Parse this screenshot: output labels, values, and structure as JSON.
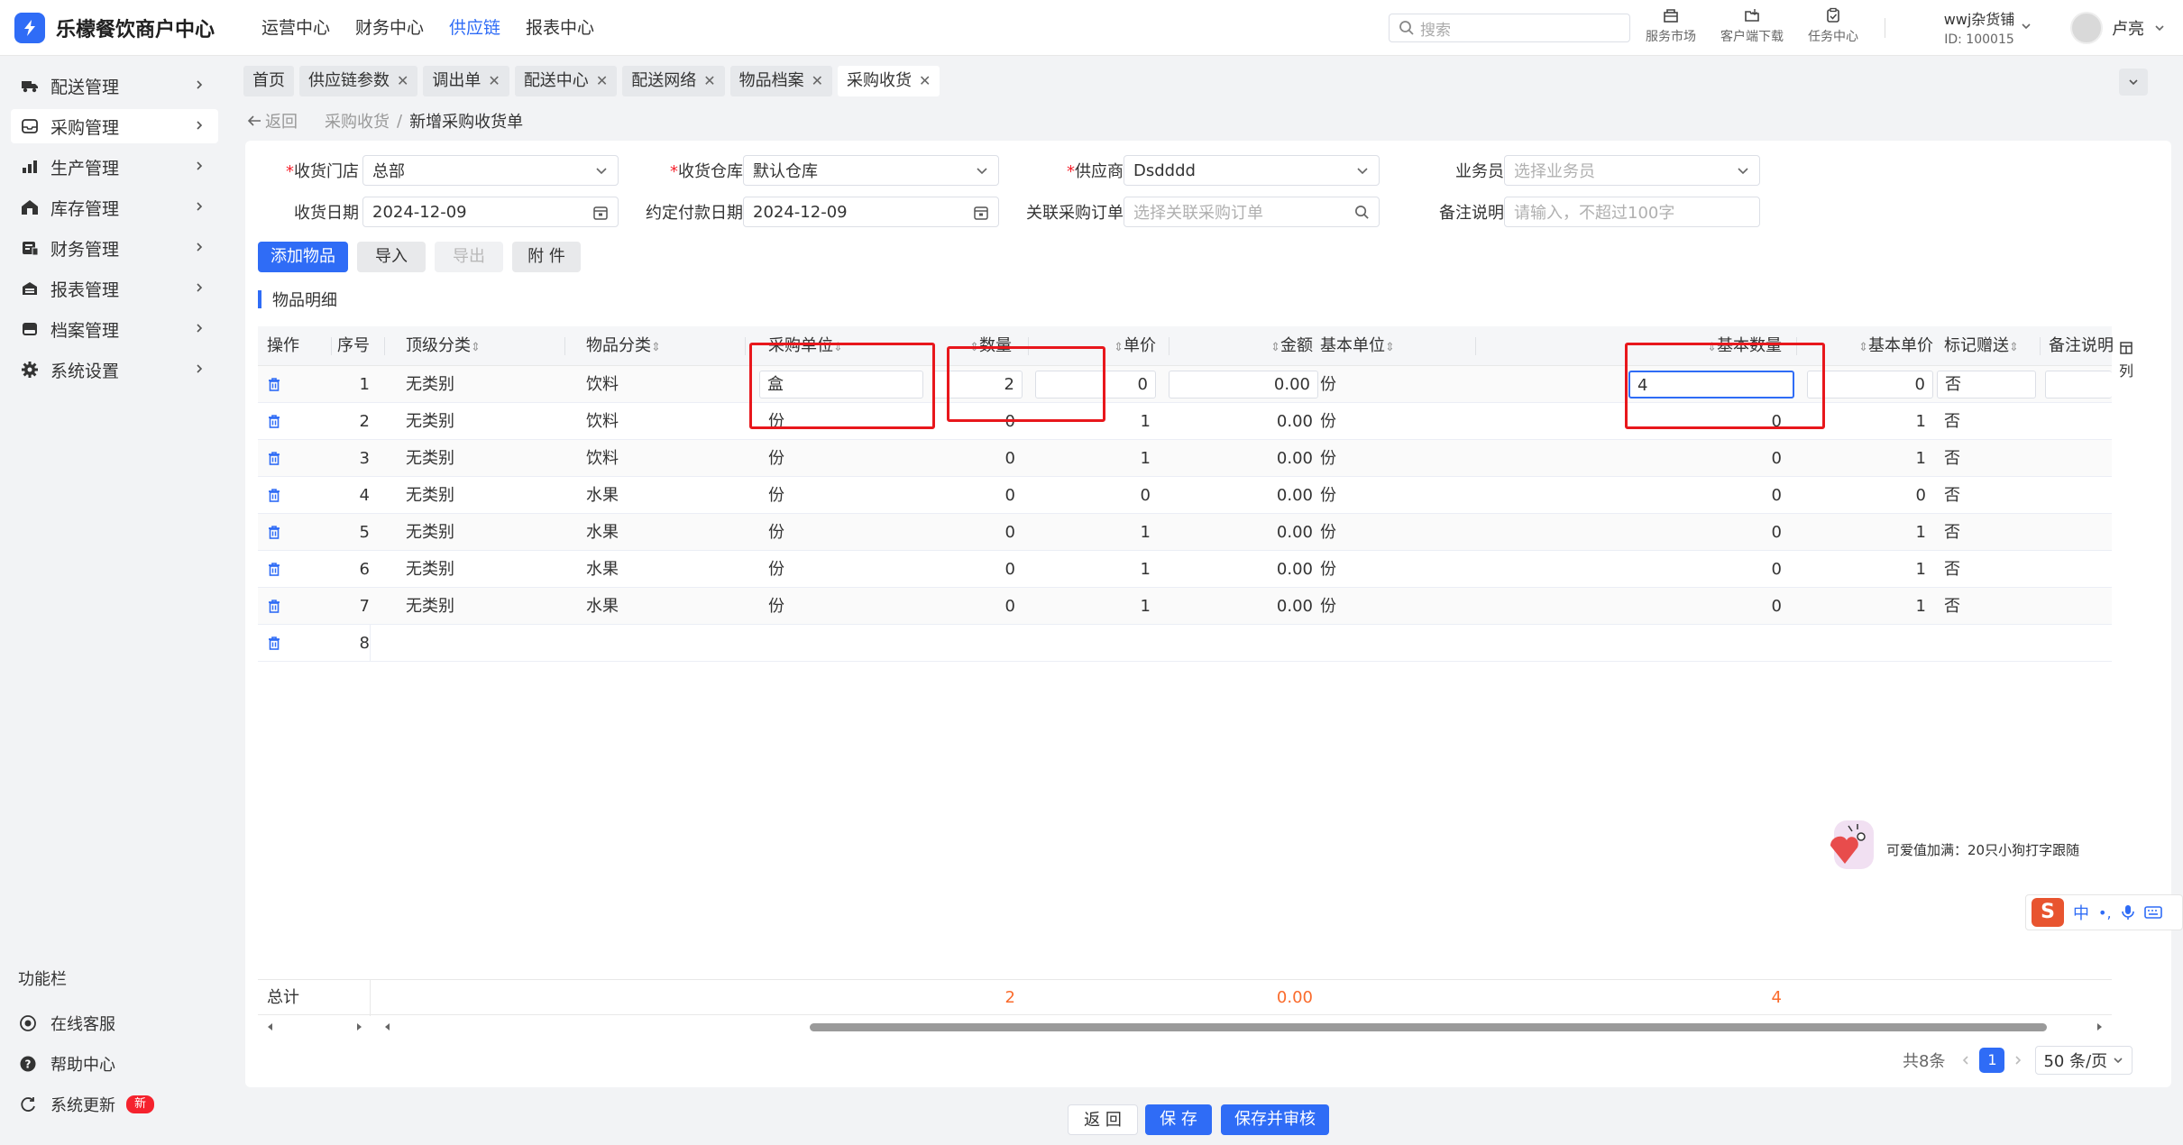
{
  "app": {
    "title": "乐檬餐饮商户中心",
    "top_nav": [
      {
        "label": "运营中心",
        "active": false
      },
      {
        "label": "财务中心",
        "active": false
      },
      {
        "label": "供应链",
        "active": true
      },
      {
        "label": "报表中心",
        "active": false
      }
    ],
    "search_placeholder": "搜索",
    "tools": [
      {
        "label": "服务市场",
        "icon": "store-icon"
      },
      {
        "label": "客户端下载",
        "icon": "download-icon"
      },
      {
        "label": "任务中心",
        "icon": "task-icon"
      }
    ],
    "store_name": "wwj杂货铺",
    "store_id": "ID: 100015",
    "user_name": "卢亮",
    "accent_color": "#2f6cf6"
  },
  "sidebar": {
    "items": [
      {
        "label": "配送管理",
        "icon": "truck-icon",
        "active": false
      },
      {
        "label": "采购管理",
        "icon": "inbox-icon",
        "active": true
      },
      {
        "label": "生产管理",
        "icon": "chart-icon",
        "active": false
      },
      {
        "label": "库存管理",
        "icon": "warehouse-icon",
        "active": false
      },
      {
        "label": "财务管理",
        "icon": "finance-icon",
        "active": false
      },
      {
        "label": "报表管理",
        "icon": "report-icon",
        "active": false
      },
      {
        "label": "档案管理",
        "icon": "archive-icon",
        "active": false
      },
      {
        "label": "系统设置",
        "icon": "gear-icon",
        "active": false
      }
    ],
    "footer_title": "功能栏",
    "footer_items": [
      {
        "label": "在线客服",
        "icon": "headset-icon"
      },
      {
        "label": "帮助中心",
        "icon": "help-icon"
      },
      {
        "label": "系统更新",
        "icon": "refresh-icon",
        "badge": "新"
      }
    ]
  },
  "tabs": [
    {
      "label": "首页",
      "closable": false,
      "active": false
    },
    {
      "label": "供应链参数",
      "closable": true,
      "active": false
    },
    {
      "label": "调出单",
      "closable": true,
      "active": false
    },
    {
      "label": "配送中心",
      "closable": true,
      "active": false
    },
    {
      "label": "配送网络",
      "closable": true,
      "active": false
    },
    {
      "label": "物品档案",
      "closable": true,
      "active": false
    },
    {
      "label": "采购收货",
      "closable": true,
      "active": true
    }
  ],
  "breadcrumb": {
    "back": "返回",
    "parent": "采购收货",
    "sep": "/",
    "current": "新增采购收货单"
  },
  "form": {
    "store_label": "收货门店",
    "store_value": "总部",
    "warehouse_label": "收货仓库",
    "warehouse_value": "默认仓库",
    "supplier_label": "供应商",
    "supplier_value": "Dsdddd",
    "salesman_label": "业务员",
    "salesman_placeholder": "选择业务员",
    "date_label": "收货日期",
    "date_value": "2024-12-09",
    "paydate_label": "约定付款日期",
    "paydate_value": "2024-12-09",
    "order_label": "关联采购订单",
    "order_placeholder": "选择关联采购订单",
    "remark_label": "备注说明",
    "remark_placeholder": "请输入，不超过100字",
    "required_mark": "*"
  },
  "actions": {
    "add": "添加物品",
    "import": "导入",
    "export": "导出",
    "attach": "附 件"
  },
  "section_title": "物品明细",
  "table": {
    "headers": {
      "op": "操作",
      "seq": "序号",
      "top_cat": "顶级分类",
      "cat": "物品分类",
      "unit": "采购单位",
      "qty": "数量",
      "price": "单价",
      "amount": "金额",
      "base_unit": "基本单位",
      "base_qty": "基本数量",
      "base_price": "基本单价",
      "gift": "标记赠送",
      "remark": "备注说明"
    },
    "sort_glyph": "⇕",
    "rows": [
      {
        "seq": "1",
        "top_cat": "无类别",
        "cat": "饮料",
        "unit": "盒",
        "qty": "2",
        "price": "0",
        "amount": "0.00",
        "base_unit": "份",
        "base_qty": "4",
        "base_price": "0",
        "gift": "否"
      },
      {
        "seq": "2",
        "top_cat": "无类别",
        "cat": "饮料",
        "unit": "份",
        "qty": "0",
        "price": "1",
        "amount": "0.00",
        "base_unit": "份",
        "base_qty": "0",
        "base_price": "1",
        "gift": "否"
      },
      {
        "seq": "3",
        "top_cat": "无类别",
        "cat": "饮料",
        "unit": "份",
        "qty": "0",
        "price": "1",
        "amount": "0.00",
        "base_unit": "份",
        "base_qty": "0",
        "base_price": "1",
        "gift": "否"
      },
      {
        "seq": "4",
        "top_cat": "无类别",
        "cat": "水果",
        "unit": "份",
        "qty": "0",
        "price": "0",
        "amount": "0.00",
        "base_unit": "份",
        "base_qty": "0",
        "base_price": "0",
        "gift": "否"
      },
      {
        "seq": "5",
        "top_cat": "无类别",
        "cat": "水果",
        "unit": "份",
        "qty": "0",
        "price": "1",
        "amount": "0.00",
        "base_unit": "份",
        "base_qty": "0",
        "base_price": "1",
        "gift": "否"
      },
      {
        "seq": "6",
        "top_cat": "无类别",
        "cat": "水果",
        "unit": "份",
        "qty": "0",
        "price": "1",
        "amount": "0.00",
        "base_unit": "份",
        "base_qty": "0",
        "base_price": "1",
        "gift": "否"
      },
      {
        "seq": "7",
        "top_cat": "无类别",
        "cat": "水果",
        "unit": "份",
        "qty": "0",
        "price": "1",
        "amount": "0.00",
        "base_unit": "份",
        "base_qty": "0",
        "base_price": "1",
        "gift": "否"
      },
      {
        "seq": "8",
        "top_cat": "",
        "cat": "",
        "unit": "",
        "qty": "",
        "price": "",
        "amount": "",
        "base_unit": "",
        "base_qty": "",
        "base_price": "",
        "gift": ""
      }
    ],
    "column_setting": "列",
    "total_label": "总计",
    "total_qty": "2",
    "total_amount": "0.00",
    "total_base_qty": "4",
    "highlight_color": "#e8171c",
    "total_color": "#fa6b2c"
  },
  "pagination": {
    "total": "共8条",
    "current": "1",
    "page_size": "50 条/页"
  },
  "float_tip": "可爱值加满：20只小狗打字跟随",
  "ime": {
    "mode": "中",
    "punct": "•,"
  },
  "footer": {
    "back": "返 回",
    "save": "保 存",
    "save_audit": "保存并审核"
  }
}
